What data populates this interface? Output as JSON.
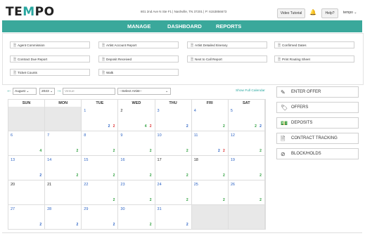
{
  "header": {
    "logo": "TEMPO",
    "address": "801 2nd Ave N Ste F1 | Nashville, TN 37201 | P: 6153856673",
    "video_tutorial": "Video Tutorial",
    "help": "Help?",
    "user": "tempo ⌄"
  },
  "nav": {
    "manage": "MANAGE",
    "dashboard": "DASHBOARD",
    "reports": "REPORTS"
  },
  "reports": [
    "Agent Commission",
    "Artist Account Report",
    "Artist Detailed Itinerary",
    "Confirmed Dates",
    "Contract Due Report",
    "Deposit Received",
    "Next to Call Report",
    "Print Routing Sheet",
    "Ticket Counts",
    "Walk"
  ],
  "controls": {
    "month": "August",
    "year": "2023",
    "venue_placeholder": "Venue",
    "artist_select": "--Select Artist--",
    "show_full_calendar": "Show Full Calendar"
  },
  "calendar": {
    "weekdays": [
      "SUN",
      "MON",
      "TUE",
      "WED",
      "THU",
      "FRI",
      "SAT"
    ],
    "weeks": [
      [
        {
          "d": "",
          "g": 1
        },
        {
          "d": "",
          "g": 1
        },
        {
          "d": "1",
          "c": "blue",
          "n": [
            [
              "2",
              "#2b62c4"
            ],
            [
              "2",
              "#d33"
            ]
          ]
        },
        {
          "d": "2",
          "c": "black",
          "n": [
            [
              "4",
              "#2a9d3a"
            ],
            [
              "2",
              "#d33"
            ]
          ]
        },
        {
          "d": "3",
          "c": "blue",
          "n": [
            [
              "2",
              "#2b62c4"
            ]
          ]
        },
        {
          "d": "4",
          "c": "blue",
          "n": [
            [
              "2",
              "#2a9d3a"
            ]
          ]
        },
        {
          "d": "5",
          "c": "blue",
          "n": [
            [
              "2",
              "#2a9d3a"
            ],
            [
              "2",
              "#2b62c4"
            ]
          ]
        }
      ],
      [
        {
          "d": "6",
          "c": "blue",
          "n": [
            [
              "4",
              "#2a9d3a"
            ]
          ]
        },
        {
          "d": "7",
          "c": "blue",
          "n": [
            [
              "2",
              "#2a9d3a"
            ]
          ]
        },
        {
          "d": "8",
          "c": "blue",
          "n": [
            [
              "2",
              "#2a9d3a"
            ]
          ]
        },
        {
          "d": "9",
          "c": "blue",
          "n": [
            [
              "2",
              "#2a9d3a"
            ]
          ]
        },
        {
          "d": "10",
          "c": "blue",
          "n": [
            [
              "2",
              "#2a9d3a"
            ]
          ]
        },
        {
          "d": "11",
          "c": "blue",
          "n": [
            [
              "2",
              "#2b62c4"
            ],
            [
              "2",
              "#d33"
            ]
          ]
        },
        {
          "d": "12",
          "c": "blue",
          "n": [
            [
              "2",
              "#2a9d3a"
            ]
          ]
        }
      ],
      [
        {
          "d": "13",
          "c": "blue",
          "n": [
            [
              "2",
              "#2b62c4"
            ]
          ]
        },
        {
          "d": "14",
          "c": "blue",
          "n": [
            [
              "2",
              "#2a9d3a"
            ]
          ]
        },
        {
          "d": "15",
          "c": "blue",
          "n": [
            [
              "2",
              "#2a9d3a"
            ]
          ]
        },
        {
          "d": "16",
          "c": "blue",
          "n": [
            [
              "2",
              "#2a9d3a"
            ]
          ]
        },
        {
          "d": "17",
          "c": "black",
          "n": [
            [
              "2",
              "#2a9d3a"
            ]
          ]
        },
        {
          "d": "18",
          "c": "black",
          "n": [
            [
              "2",
              "#2a9d3a"
            ]
          ]
        },
        {
          "d": "19",
          "c": "blue",
          "n": [
            [
              "2",
              "#2a9d3a"
            ]
          ]
        }
      ],
      [
        {
          "d": "20",
          "c": "black",
          "n": []
        },
        {
          "d": "21",
          "c": "black",
          "n": []
        },
        {
          "d": "22",
          "c": "blue",
          "n": [
            [
              "2",
              "#2a9d3a"
            ]
          ]
        },
        {
          "d": "23",
          "c": "blue",
          "n": [
            [
              "2",
              "#2a9d3a"
            ]
          ]
        },
        {
          "d": "24",
          "c": "blue",
          "n": [
            [
              "2",
              "#2a9d3a"
            ]
          ]
        },
        {
          "d": "25",
          "c": "blue",
          "n": [
            [
              "2",
              "#2a9d3a"
            ]
          ]
        },
        {
          "d": "26",
          "c": "blue",
          "n": [
            [
              "2",
              "#2a9d3a"
            ]
          ]
        }
      ],
      [
        {
          "d": "27",
          "c": "blue",
          "n": [
            [
              "2",
              "#2b62c4"
            ]
          ]
        },
        {
          "d": "28",
          "c": "blue",
          "n": [
            [
              "2",
              "#2b62c4"
            ]
          ]
        },
        {
          "d": "29",
          "c": "blue",
          "n": [
            [
              "2",
              "#2b62c4"
            ]
          ]
        },
        {
          "d": "30",
          "c": "blue",
          "n": [
            [
              "2",
              "#2a9d3a"
            ]
          ]
        },
        {
          "d": "31",
          "c": "blue",
          "n": [
            [
              "2",
              "#2b62c4"
            ]
          ]
        },
        {
          "d": "",
          "g": 1
        },
        {
          "d": "",
          "g": 1
        }
      ]
    ]
  },
  "sidebar": [
    {
      "label": "ENTER OFFER",
      "icon": "edit-icon"
    },
    {
      "label": "OFFERS",
      "icon": "tag-icon"
    },
    {
      "label": "DEPOSITS",
      "icon": "money-icon"
    },
    {
      "label": "CONTRACT TRACKING",
      "icon": "document-icon"
    },
    {
      "label": "BLOCK/HOLDS",
      "icon": "block-icon"
    }
  ],
  "colors": {
    "accent": "#3aa89b",
    "date_blue": "#2b62c4",
    "count_green": "#2a9d3a",
    "count_red": "#d33"
  }
}
